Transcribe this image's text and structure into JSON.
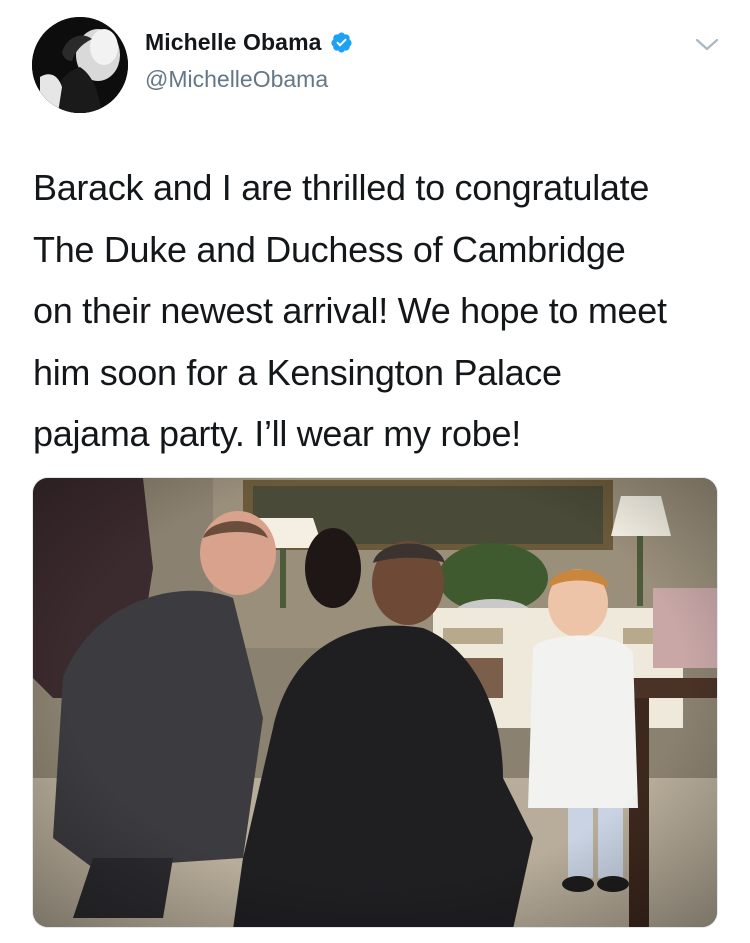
{
  "tweet": {
    "author_name": "Michelle Obama",
    "author_handle": "@MichelleObama",
    "verified": true,
    "text_lines": [
      "Barack and I are thrilled to congratulate",
      "The Duke and Duchess of Cambridge",
      "on their newest arrival! We hope to meet",
      "him soon for a Kensington Palace",
      "pajama party. I’ll wear my robe!"
    ]
  },
  "icons": {
    "verified": "verified-badge-icon",
    "menu": "chevron-down-icon"
  },
  "colors": {
    "text_primary": "#14171a",
    "text_secondary": "#657786",
    "verified_blue": "#1da1f2",
    "chevron_gray": "#aab8c2"
  }
}
